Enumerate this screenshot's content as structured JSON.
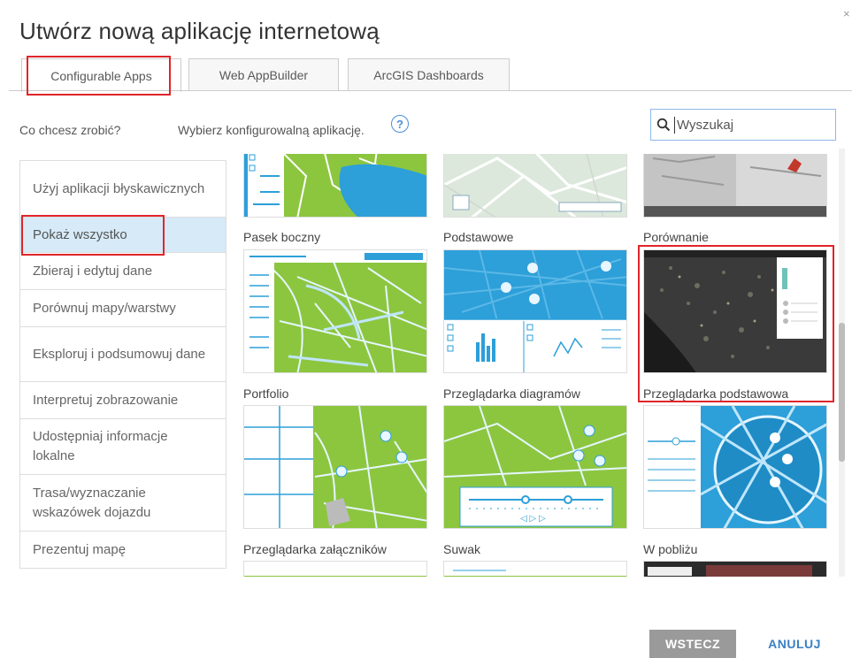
{
  "dialog": {
    "title": "Utwórz nową aplikację internetową",
    "close_icon": "close-icon"
  },
  "tabs": [
    {
      "label": "Configurable Apps",
      "active": true
    },
    {
      "label": "Web AppBuilder",
      "active": false
    },
    {
      "label": "ArcGIS Dashboards",
      "active": false
    }
  ],
  "filters": {
    "question_label": "Co chcesz zrobić?",
    "choose_label": "Wybierz konfigurowalną aplikację.",
    "help_icon": "?"
  },
  "search": {
    "placeholder": "Wyszukaj",
    "value": ""
  },
  "sidebar": {
    "items": [
      {
        "label": "Użyj aplikacji błyskawicznych",
        "active": false
      },
      {
        "label": "Pokaż wszystko",
        "active": true
      },
      {
        "label": "Zbieraj i edytuj dane",
        "active": false
      },
      {
        "label": "Porównuj mapy/warstwy",
        "active": false
      },
      {
        "label": "Eksploruj i podsumowuj dane",
        "active": false
      },
      {
        "label": "Interpretuj zobrazowanie",
        "active": false
      },
      {
        "label": "Udostępniaj informacje lokalne",
        "active": false
      },
      {
        "label": "Trasa/wyznaczanie wskazówek dojazdu",
        "active": false
      },
      {
        "label": "Prezentuj mapę",
        "active": false
      }
    ]
  },
  "gallery": {
    "captions": [
      "Pasek boczny",
      "Podstawowe",
      "Porównanie",
      "Portfolio",
      "Przeglądarka diagramów",
      "Przeglądarka podstawowa",
      "Przeglądarka załączników",
      "Suwak",
      "W pobliżu"
    ],
    "highlighted": "Przeglądarka podstawowa"
  },
  "footer": {
    "back_label": "WSTECZ",
    "cancel_label": "ANULUJ"
  },
  "colors": {
    "accent": "#3a7fc4",
    "highlight_box": "#e0252b",
    "active_sidebar": "#d6eaf8",
    "map_green": "#8cc63f",
    "map_blue": "#2d9fd9"
  }
}
